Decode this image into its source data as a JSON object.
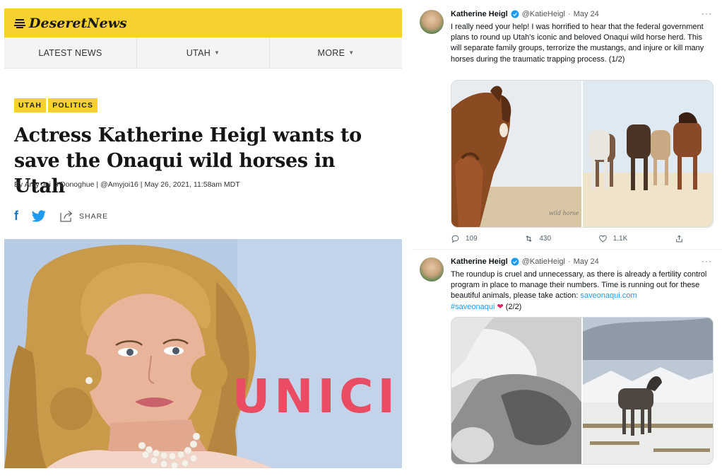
{
  "article": {
    "logo_text": "DeseretNews",
    "nav": [
      {
        "label": "LATEST NEWS"
      },
      {
        "label": "UTAH"
      },
      {
        "label": "MORE"
      }
    ],
    "tags": [
      "UTAH",
      "POLITICS"
    ],
    "headline": "Actress Katherine Heigl wants to save the Onaqui wild horses in Utah",
    "byline": "By Amy Joi O'Donoghue | @Amyjoi16 | May 26, 2021, 11:58am MDT",
    "share_label": "SHARE",
    "hero_text": "UNICI",
    "colors": {
      "brand": "#f7d12e",
      "facebook": "#1877c9",
      "twitter": "#1d9bf0"
    }
  },
  "tweets": [
    {
      "name": "Katherine Heigl",
      "handle": "@KatieHeigl",
      "date": "May 24",
      "more": "···",
      "text": "I really need your help! I was horrified to hear that the federal government plans to round up Utah's iconic and beloved Onaqui wild horse herd. This will separate family groups, terrorize the mustangs, and injure or kill many horses during the traumatic trapping process. (1/2)",
      "watermark": "wild horse",
      "replies": "109",
      "retweets": "430",
      "likes": "1.1K"
    },
    {
      "name": "Katherine Heigl",
      "handle": "@KatieHeigl",
      "date": "May 24",
      "more": "···",
      "text_before": "The roundup is cruel and unnecessary, as there is already a fertility control program in place to manage their numbers. Time is running out for these beautiful animals, please take action: ",
      "link": "saveonaqui.com",
      "hashtag": "#saveonaqui",
      "heart": "❤",
      "suffix": " (2/2)"
    }
  ]
}
